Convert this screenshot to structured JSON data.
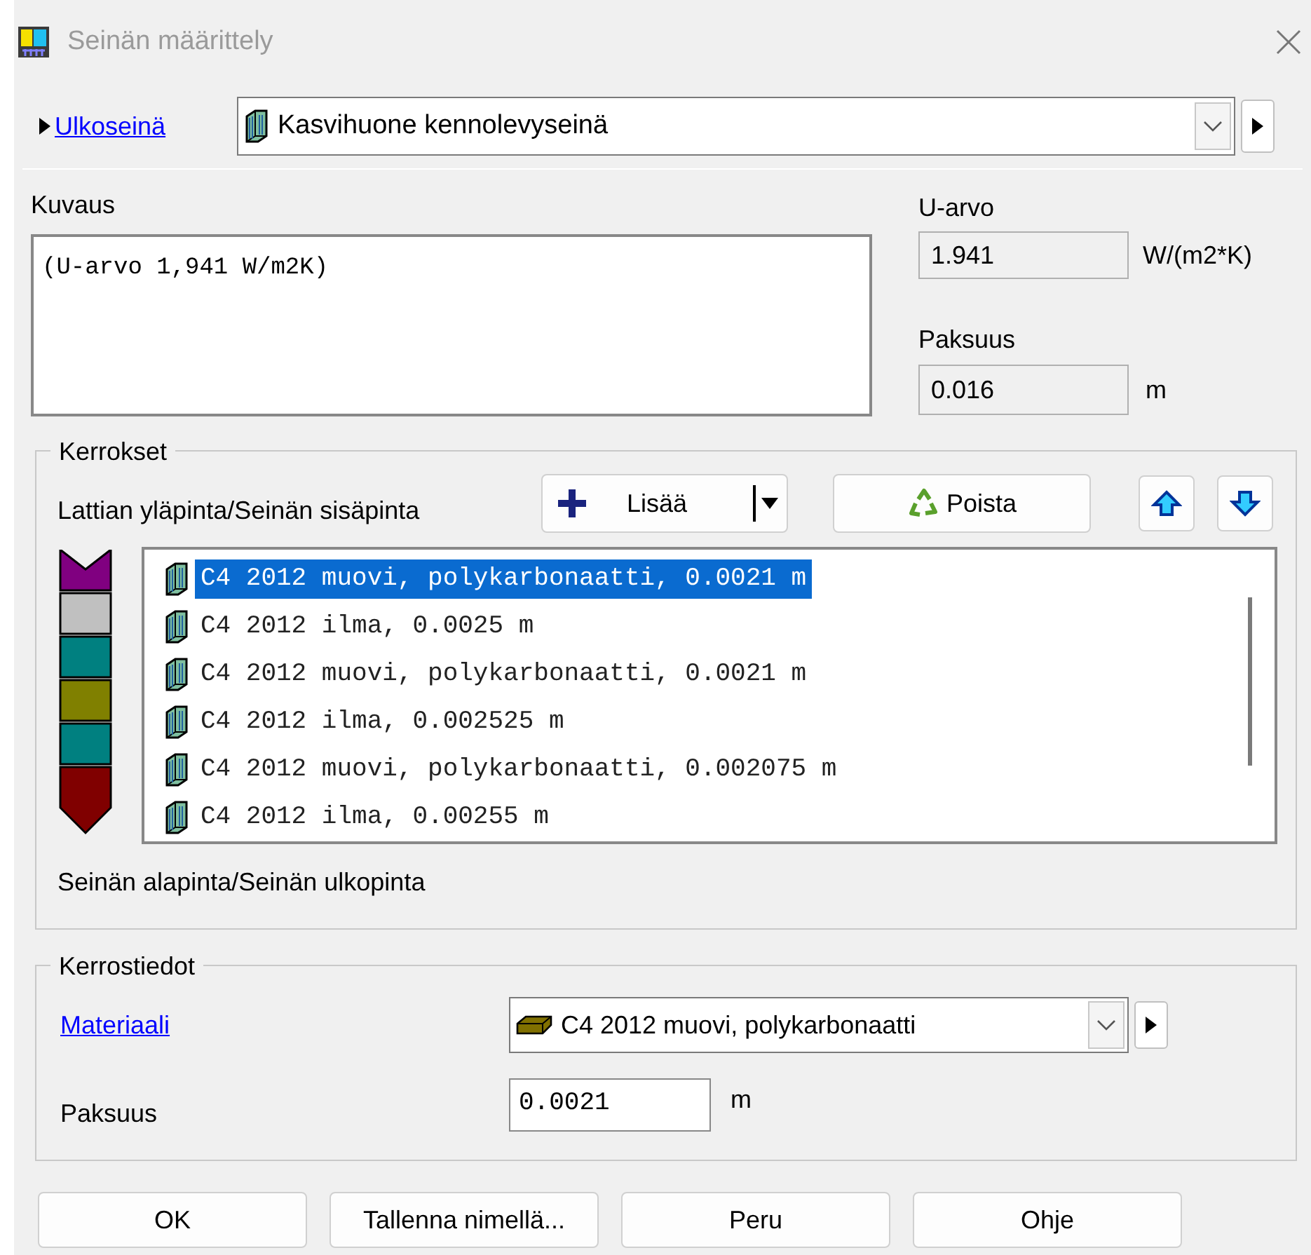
{
  "window": {
    "title": "Seinän määrittely"
  },
  "wall_type": {
    "link": "Ulkoseinä",
    "value": "Kasvihuone kennolevyseinä"
  },
  "description": {
    "label": "Kuvaus",
    "value": "(U-arvo 1,941 W/m2K)"
  },
  "u_value": {
    "label": "U-arvo",
    "value": "1.941",
    "unit": "W/(m2*K)"
  },
  "thickness": {
    "label": "Paksuus",
    "value": "0.016",
    "unit": "m"
  },
  "layers": {
    "title": "Kerrokset",
    "top_label": "Lattian yläpinta/Seinän sisäpinta",
    "add_button": "Lisää",
    "remove_button": "Poista",
    "bottom_label": "Seinän alapinta/Seinän ulkopinta",
    "items": [
      {
        "text": "C4 2012 muovi, polykarbonaatti, 0.0021 m",
        "color": "#800080",
        "selected": true
      },
      {
        "text": "C4 2012 ilma, 0.0025 m",
        "color": "#c0c0c0",
        "selected": false
      },
      {
        "text": "C4 2012 muovi, polykarbonaatti, 0.0021 m",
        "color": "#008080",
        "selected": false
      },
      {
        "text": "C4 2012 ilma, 0.002525 m",
        "color": "#808000",
        "selected": false
      },
      {
        "text": "C4 2012 muovi, polykarbonaatti, 0.002075 m",
        "color": "#008080",
        "selected": false
      },
      {
        "text": "C4 2012 ilma, 0.00255 m",
        "color": "#800000",
        "selected": false
      }
    ]
  },
  "layer_details": {
    "title": "Kerrostiedot",
    "material_link": "Materiaali",
    "material": "C4 2012 muovi, polykarbonaatti",
    "thickness_label": "Paksuus",
    "thickness": "0.0021",
    "unit": "m"
  },
  "buttons": [
    "OK",
    "Tallenna nimellä...",
    "Peru",
    "Ohje"
  ]
}
